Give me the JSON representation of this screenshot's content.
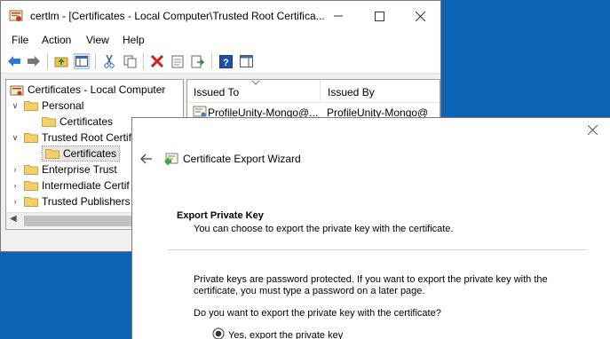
{
  "window": {
    "title": "certlm - [Certificates - Local Computer\\Trusted Root Certifica...",
    "app_icon": "certificate-manager-icon",
    "caption_buttons": [
      "minimize-icon",
      "maximize-icon",
      "close-icon"
    ]
  },
  "menu": [
    "File",
    "Action",
    "View",
    "Help"
  ],
  "toolbar": {
    "buttons": [
      "back-arrow-icon",
      "forward-arrow-icon",
      "up-folder-icon",
      "show-hide-tree-icon",
      "cut-icon",
      "copy-icon",
      "delete-icon",
      "properties-icon",
      "export-list-icon",
      "help-icon",
      "action-pane-icon"
    ]
  },
  "tree": {
    "root": "Certificates - Local Computer",
    "items": [
      {
        "label": "Personal",
        "expanded": true
      },
      {
        "label": "Certificates",
        "child": true
      },
      {
        "label": "Trusted Root Certif",
        "expanded": true
      },
      {
        "label": "Certificates",
        "child": true,
        "selected": true
      },
      {
        "label": "Enterprise Trust"
      },
      {
        "label": "Intermediate Certif"
      },
      {
        "label": "Trusted Publishers"
      }
    ]
  },
  "list": {
    "columns": [
      "Issued To",
      "Issued By"
    ],
    "rows": [
      {
        "issued_to": "ProfileUnity-Mongo@...",
        "issued_by": "ProfileUnity-Mongo@"
      }
    ]
  },
  "wizard": {
    "title": "Certificate Export Wizard",
    "section_heading": "Export Private Key",
    "section_subtitle": "You can choose to export the private key with the certificate.",
    "body_line1": "Private keys are password protected. If you want to export the private key with the",
    "body_line2": "certificate, you must type a password on a later page.",
    "question": "Do you want to export the private key with the certificate?",
    "option_yes": "Yes, export the private key",
    "option_yes_selected": true
  }
}
